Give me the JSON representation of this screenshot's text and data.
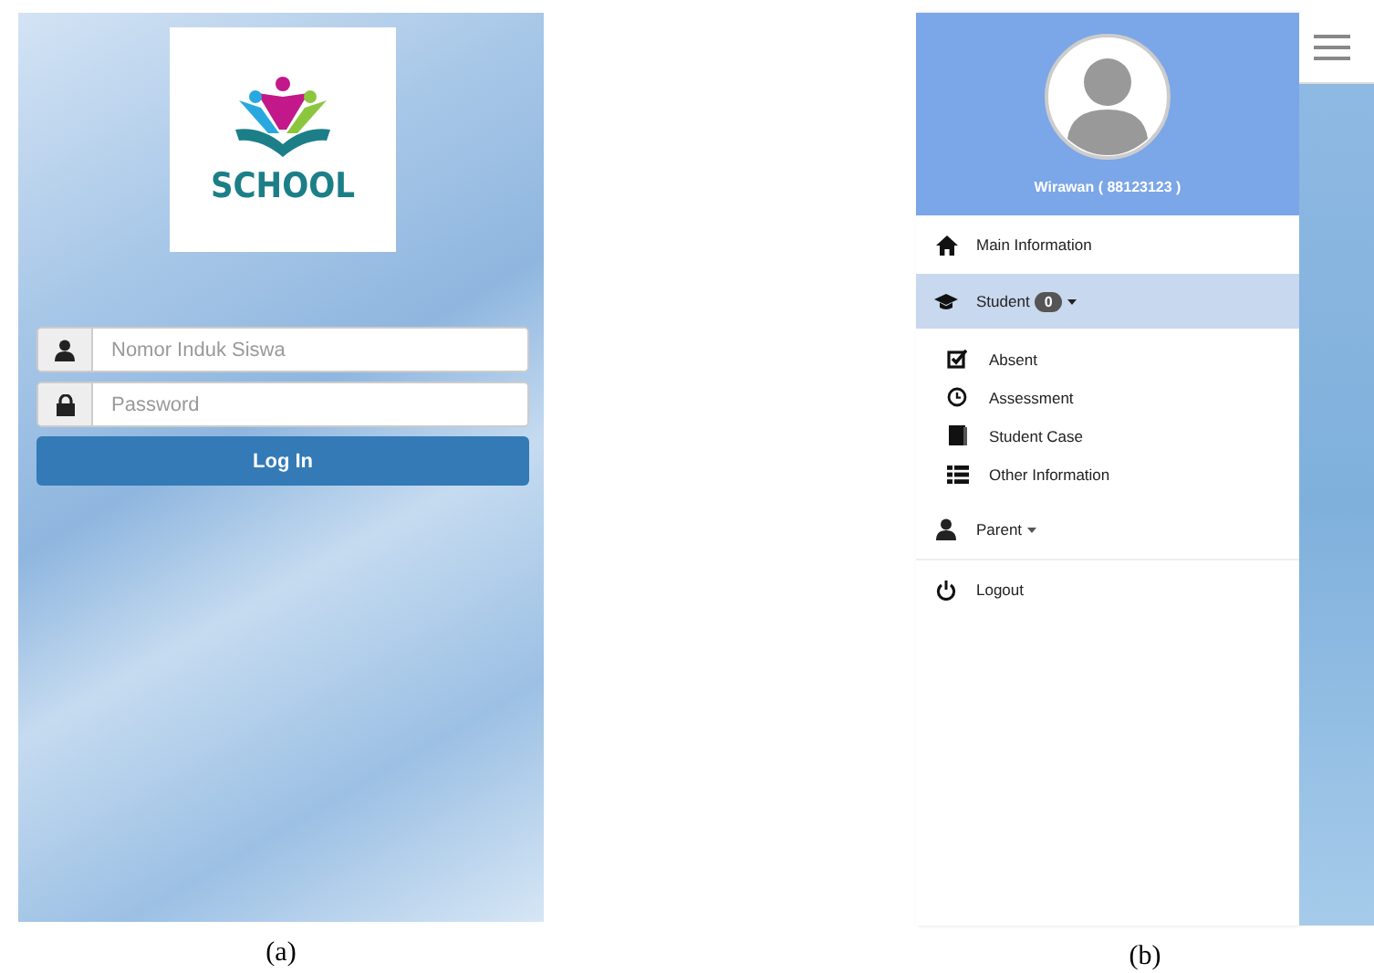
{
  "login_screen": {
    "logo_text": "SCHOOL",
    "fields": [
      {
        "kind": "user",
        "placeholder": "Nomor Induk Siswa"
      },
      {
        "kind": "lock",
        "placeholder": "Password"
      }
    ],
    "login_button": "Log In",
    "caption": "(a)"
  },
  "menu_screen": {
    "user_name": "Wirawan ( 88123123 )",
    "menu": [
      {
        "kind": "home",
        "label": "Main Information",
        "selected": false
      },
      {
        "kind": "cap",
        "label": "Student",
        "badge": "0",
        "selected": true,
        "expanded": true,
        "children": [
          {
            "kind": "check",
            "label": "Absent"
          },
          {
            "kind": "clock",
            "label": "Assessment"
          },
          {
            "kind": "book",
            "label": "Student Case"
          },
          {
            "kind": "list",
            "label": "Other Information"
          }
        ]
      },
      {
        "kind": "user",
        "label": "Parent",
        "selected": false,
        "expanded": false
      },
      {
        "kind": "power",
        "label": "Logout",
        "selected": false
      }
    ],
    "caption": "(b)"
  }
}
